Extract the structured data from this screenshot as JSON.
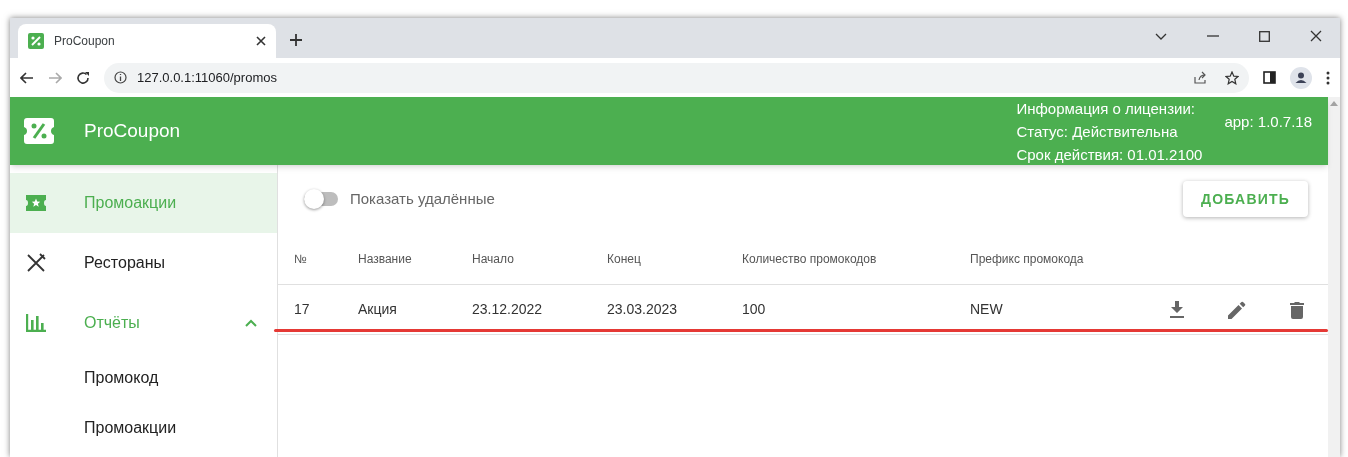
{
  "browser": {
    "tabs": [
      {
        "title": "ProCoupon",
        "selected": true
      }
    ],
    "address": "127.0.0.1:11060/promos"
  },
  "header": {
    "title": "ProCoupon",
    "license": [
      "Информация о лицензии:",
      "Статус: Действительна",
      "Срок действия: 01.01.2100"
    ],
    "version": "app: 1.0.7.18"
  },
  "sidebar": {
    "items": [
      {
        "label": "Промоакции",
        "selected": true
      },
      {
        "label": "Рестораны",
        "selected": false
      },
      {
        "label": "Отчёты",
        "selected": false,
        "expanded": true,
        "children": [
          {
            "label": "Промокод",
            "selected": false
          },
          {
            "label": "Промоакции",
            "selected": false
          }
        ]
      }
    ]
  },
  "toolbar": {
    "toggle": {
      "label": "Показать удалённые",
      "on": false
    },
    "add_button": "ДОБАВИТЬ"
  },
  "table": {
    "columns": [
      "№",
      "Название",
      "Начало",
      "Конец",
      "Количество промокодов",
      "Префикс промокода"
    ],
    "rows": [
      {
        "cells": [
          "17",
          "Акция",
          "23.12.2022",
          "23.03.2023",
          "100",
          "NEW"
        ],
        "underlined": true
      }
    ]
  }
}
